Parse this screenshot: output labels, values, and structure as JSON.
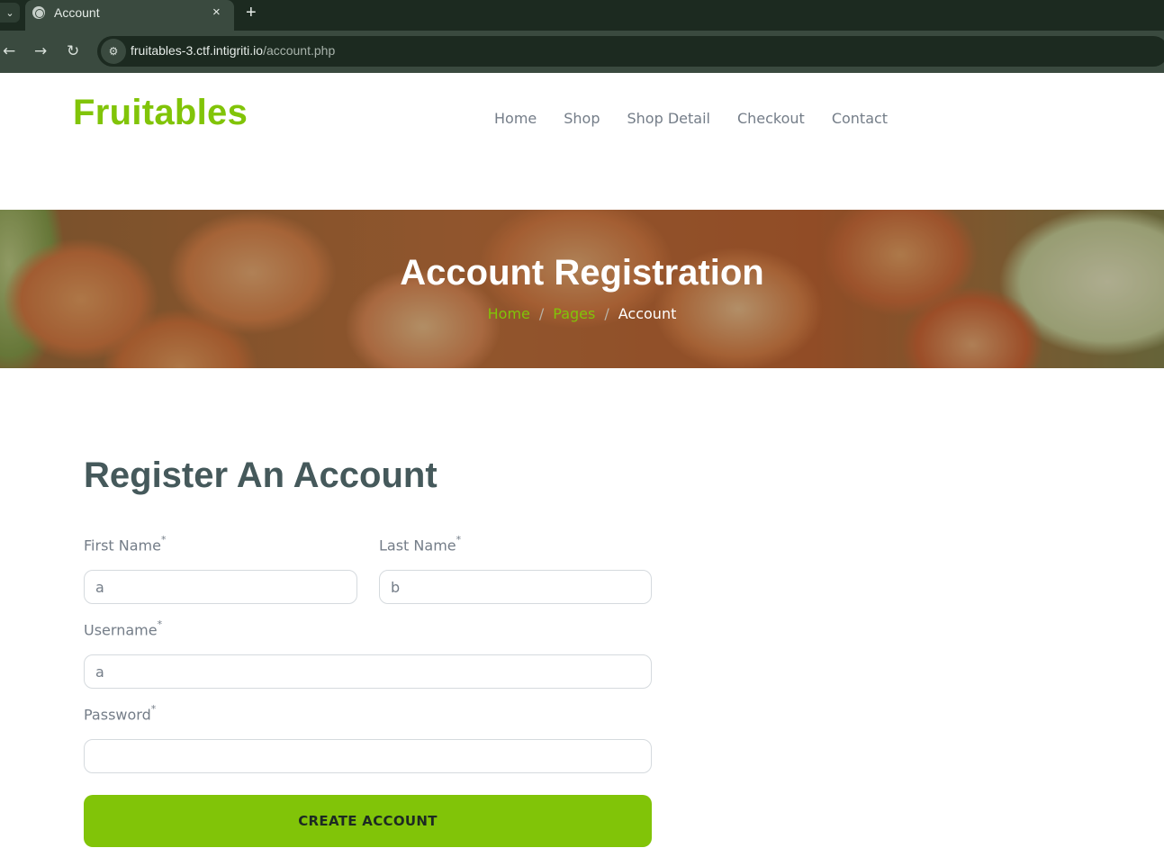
{
  "browser": {
    "tab_title": "Account",
    "tab_close": "×",
    "new_tab": "+",
    "url_host": "fruitables-3.ctf.intigriti.io",
    "url_path": "/account.php"
  },
  "site": {
    "brand": "Fruitables",
    "nav": [
      "Home",
      "Shop",
      "Shop Detail",
      "Checkout",
      "Contact"
    ]
  },
  "hero": {
    "title": "Account Registration",
    "breadcrumb": {
      "home": "Home",
      "pages": "Pages",
      "current": "Account",
      "separator": "/"
    }
  },
  "form": {
    "title": "Register An Account",
    "required_mark": "*",
    "first_name": {
      "label": "First Name",
      "value": "a"
    },
    "last_name": {
      "label": "Last Name",
      "value": "b"
    },
    "username": {
      "label": "Username",
      "value": "a"
    },
    "password": {
      "label": "Password",
      "value": ""
    },
    "submit_label": "CREATE ACCOUNT"
  },
  "colors": {
    "accent": "#81c408",
    "heading": "#45595b",
    "muted_text": "#747d88"
  },
  "icons": [
    "chevron-down-icon",
    "globe-icon",
    "close-icon",
    "plus-icon",
    "back-arrow-icon",
    "forward-arrow-icon",
    "reload-icon",
    "site-settings-icon"
  ]
}
